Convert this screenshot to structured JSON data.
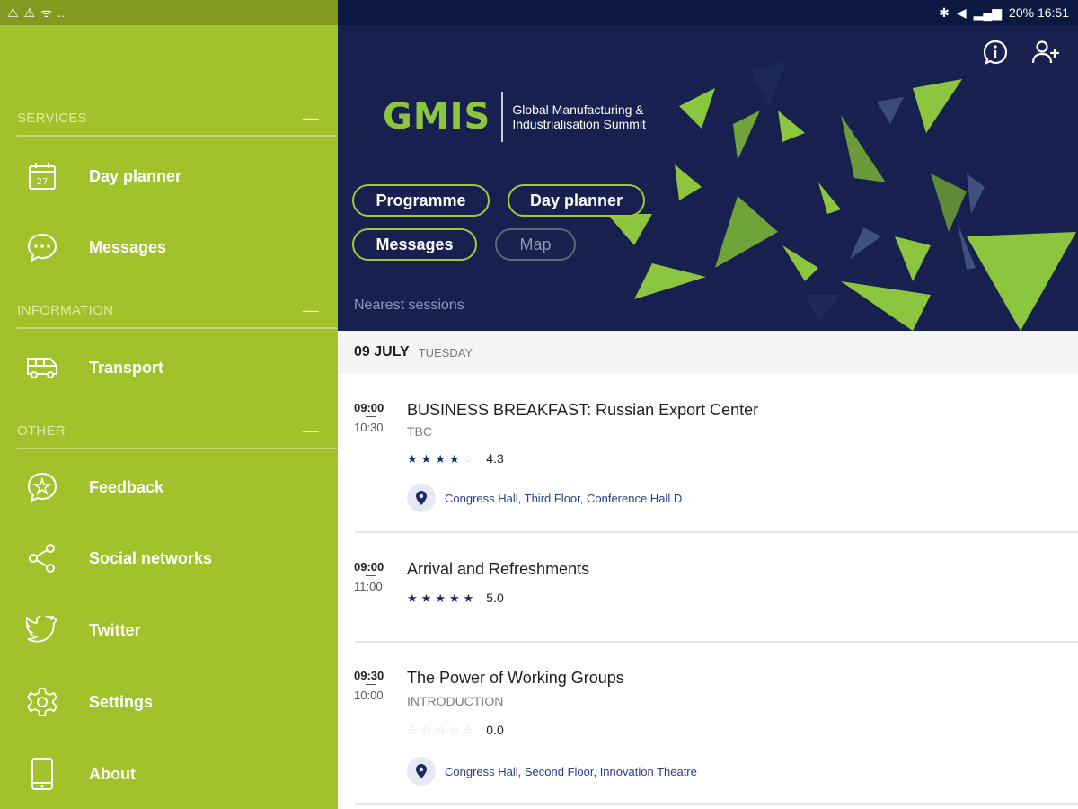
{
  "status": {
    "right": "20% 16:51",
    "left_dots": "..."
  },
  "sidebar": {
    "sections": [
      {
        "title": "SERVICES",
        "items": [
          {
            "label": "Day planner",
            "icon": "calendar-icon",
            "icon_text": "27"
          },
          {
            "label": "Messages",
            "icon": "chat-bubble-icon"
          }
        ]
      },
      {
        "title": "INFORMATION",
        "items": [
          {
            "label": "Transport",
            "icon": "bus-icon"
          }
        ]
      },
      {
        "title": "OTHER",
        "items": [
          {
            "label": "Feedback",
            "icon": "feedback-star-icon"
          },
          {
            "label": "Social networks",
            "icon": "share-icon"
          },
          {
            "label": "Twitter",
            "icon": "twitter-icon"
          },
          {
            "label": "Settings",
            "icon": "gear-icon"
          },
          {
            "label": "About",
            "icon": "phone-icon"
          }
        ]
      }
    ],
    "collapse_symbol": "—"
  },
  "header": {
    "logo_mark": "GMIS",
    "logo_text": "Global Manufacturing & Industrialisation Summit",
    "buttons": [
      {
        "label": "Programme",
        "enabled": true
      },
      {
        "label": "Day planner",
        "enabled": true
      },
      {
        "label": "Messages",
        "enabled": true
      },
      {
        "label": "Map",
        "enabled": false
      }
    ],
    "nearest_label": "Nearest sessions",
    "icons": [
      "info-icon",
      "add-user-icon"
    ],
    "colors": {
      "background": "#17204f",
      "accent": "#8cc63f",
      "sidebar": "#a2c22b"
    }
  },
  "schedule": {
    "date": "09 JULY",
    "weekday": "TUESDAY",
    "sessions": [
      {
        "start": "09:00",
        "end": "10:30",
        "title": "BUSINESS BREAKFAST: Russian Export Center",
        "subtitle": "TBC",
        "rating": 4.3,
        "rating_text": "4.3",
        "stars": 4,
        "location": "Congress Hall, Third Floor, Conference Hall D"
      },
      {
        "start": "09:00",
        "end": "11:00",
        "title": "Arrival and Refreshments",
        "subtitle": "",
        "rating": 5.0,
        "rating_text": "5.0",
        "stars": 5,
        "location": ""
      },
      {
        "start": "09:30",
        "end": "10:00",
        "title": "The Power of Working Groups",
        "subtitle": "INTRODUCTION",
        "rating": 0.0,
        "rating_text": "0.0",
        "stars": 0,
        "location": "Congress Hall, Second Floor, Innovation Theatre"
      }
    ]
  }
}
